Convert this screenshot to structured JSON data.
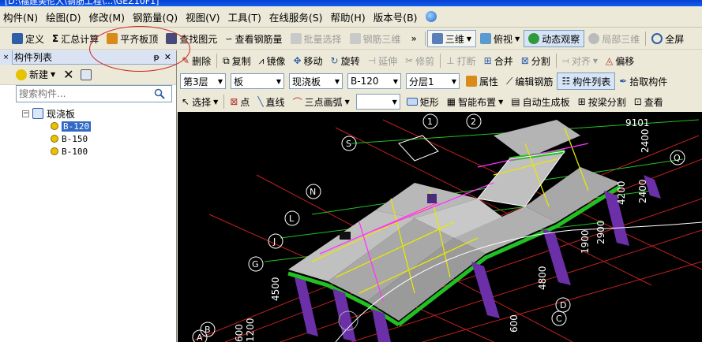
{
  "title": "[D:\\福建美伦大\\钢筋工程\\...\\GEZ10F1]",
  "menu": [
    {
      "label": "构件(N)"
    },
    {
      "label": "绘图(D)"
    },
    {
      "label": "修改(M)"
    },
    {
      "label": "钢筋量(Q)"
    },
    {
      "label": "视图(V)"
    },
    {
      "label": "工具(T)"
    },
    {
      "label": "在线服务(S)"
    },
    {
      "label": "帮助(H)"
    },
    {
      "label": "版本号(B)"
    }
  ],
  "toolbar1": {
    "define": "定义",
    "summary_calc": "汇总计算",
    "flush_slab_top": "平齐板顶",
    "find_element": "查找图元",
    "view_rebar": "查看钢筋量",
    "batch_select": "批量选择",
    "rebar_3d": "钢筋三维",
    "view_3d": "三维",
    "top_view": "俯视",
    "dynamic_observe": "动态观察",
    "local_3d": "局部三维",
    "fullscreen": "全屏"
  },
  "toolbar2": {
    "delete": "删除",
    "copy": "复制",
    "mirror": "镜像",
    "move": "移动",
    "rotate": "旋转",
    "extend": "延伸",
    "trim": "修剪",
    "break": "打断",
    "merge": "合并",
    "split": "分割",
    "align": "对齐",
    "offset": "偏移"
  },
  "toolbar3": {
    "floor": "第3层",
    "category": "板",
    "type": "现浇板",
    "element": "B-120",
    "layer": "分层1",
    "properties": "属性",
    "edit_rebar": "编辑钢筋",
    "component_list": "构件列表",
    "pick_component": "拾取构件"
  },
  "toolbar4": {
    "select": "选择",
    "point": "点",
    "line": "直线",
    "three_point_arc": "三点画弧",
    "rectangle": "矩形",
    "smart_layout": "智能布置",
    "auto_generate_slab": "自动生成板",
    "split_by_beam": "按梁分割",
    "view": "查看"
  },
  "panel": {
    "title": "构件列表",
    "new_button": "新建",
    "search_placeholder": "搜索构件...",
    "tree": {
      "root": "现浇板",
      "items": [
        {
          "label": "B-120",
          "selected": true
        },
        {
          "label": "B-150",
          "selected": false
        },
        {
          "label": "B-100",
          "selected": false
        }
      ]
    }
  },
  "canvas": {
    "axis_tags": [
      "1",
      "2",
      "S",
      "Q",
      "N",
      "L",
      "J",
      "G",
      "D",
      "C",
      "B",
      "A"
    ],
    "dimensions": [
      "9101",
      "2400",
      "4200",
      "2400",
      "2900",
      "1900",
      "4800",
      "4500",
      "600",
      "1200",
      "600"
    ],
    "colors": {
      "background": "#000000",
      "slab": "#c0c0c0",
      "column": "#6b2fa8",
      "beam_edge": "#22c022",
      "rebar_line": "#e8e800",
      "magenta": "#ff33ff",
      "grid_red": "#c02020"
    }
  }
}
